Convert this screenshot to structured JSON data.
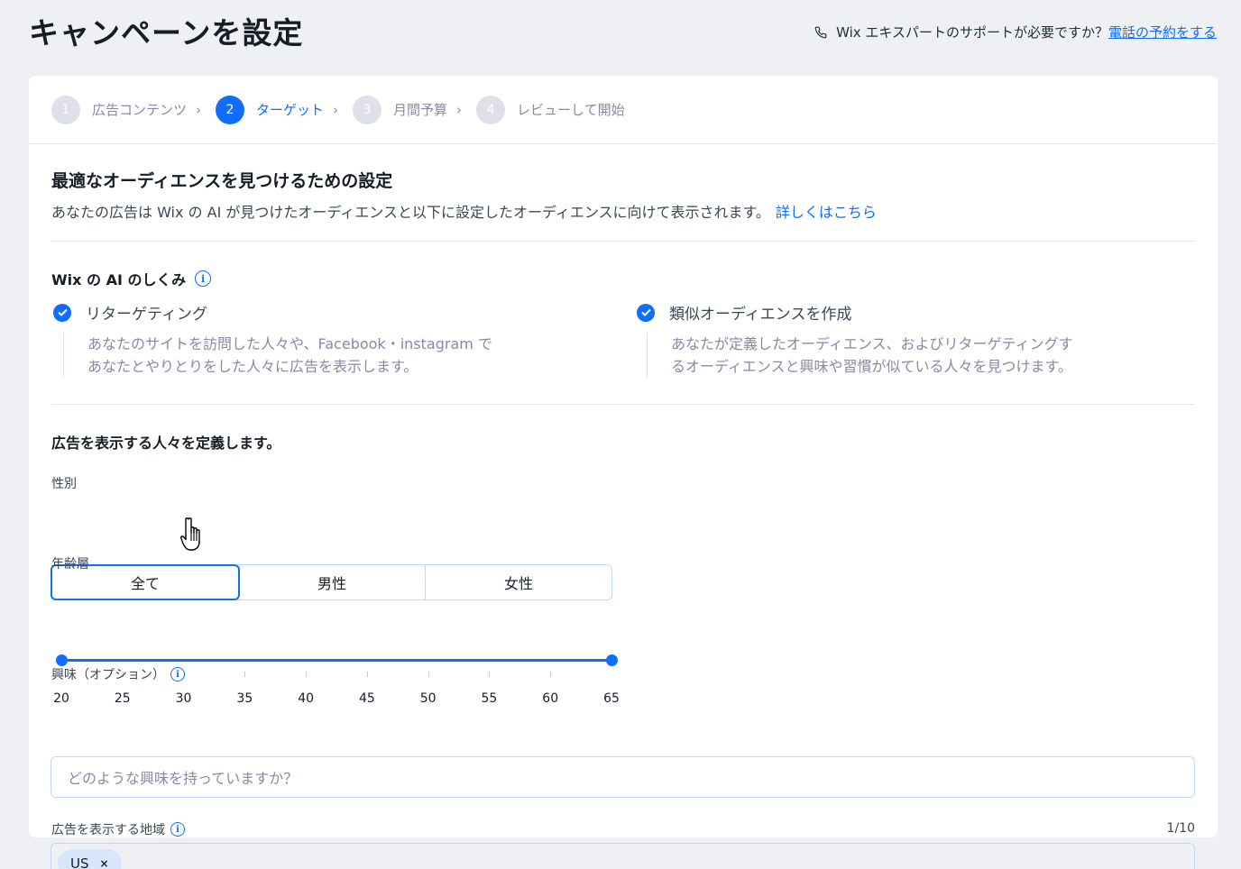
{
  "page": {
    "title": "キャンペーンを設定",
    "help_text": "Wix エキスパートのサポートが必要ですか？",
    "help_link": "電話の予約をする"
  },
  "stepper": {
    "steps": [
      {
        "num": "1",
        "label": "広告コンテンツ",
        "state": "inactive"
      },
      {
        "num": "2",
        "label": "ターゲット",
        "state": "active"
      },
      {
        "num": "3",
        "label": "月間予算",
        "state": "inactive"
      },
      {
        "num": "4",
        "label": "レビューして開始",
        "state": "inactive"
      }
    ],
    "chevron": "›"
  },
  "audience": {
    "title": "最適なオーディエンスを見つけるための設定",
    "description": "あなたの広告は Wix の AI が見つけたオーディエンスと以下に設定したオーディエンスに向けて表示されます。",
    "learn_more": "詳しくはこちら"
  },
  "ai": {
    "title": "Wix の AI のしくみ",
    "info_glyph": "i",
    "retargeting": {
      "title": "リターゲティング",
      "desc_line1": "あなたのサイトを訪問した人々や、Facebook・instagram で",
      "desc_line2": "あなたとやりとりをした人々に広告を表示します。"
    },
    "lookalike": {
      "title": "類似オーディエンスを作成",
      "desc_line1": "あなたが定義したオーディエンス、およびリターゲティングす",
      "desc_line2": "るオーディエンスと興味や習慣が似ている人々を見つけます。"
    }
  },
  "define": {
    "title": "広告を表示する人々を定義します。",
    "gender_label": "性別",
    "gender_options": [
      "全て",
      "男性",
      "女性"
    ],
    "gender_selected": "全て",
    "age_label": "年齢層",
    "age_ticks": [
      "20",
      "25",
      "30",
      "35",
      "40",
      "45",
      "50",
      "55",
      "60",
      "65"
    ],
    "age_min": 20,
    "age_max": 65,
    "interests_label": "興味（オプション）",
    "interests_placeholder": "どのような興味を持っていますか？",
    "location_label": "広告を表示する地域",
    "location_count": "1/10",
    "location_tags": [
      "US"
    ],
    "tag_remove": "×"
  },
  "colors": {
    "accent": "#116dff",
    "background": "#eef0f4",
    "border": "#c1d7f8"
  }
}
